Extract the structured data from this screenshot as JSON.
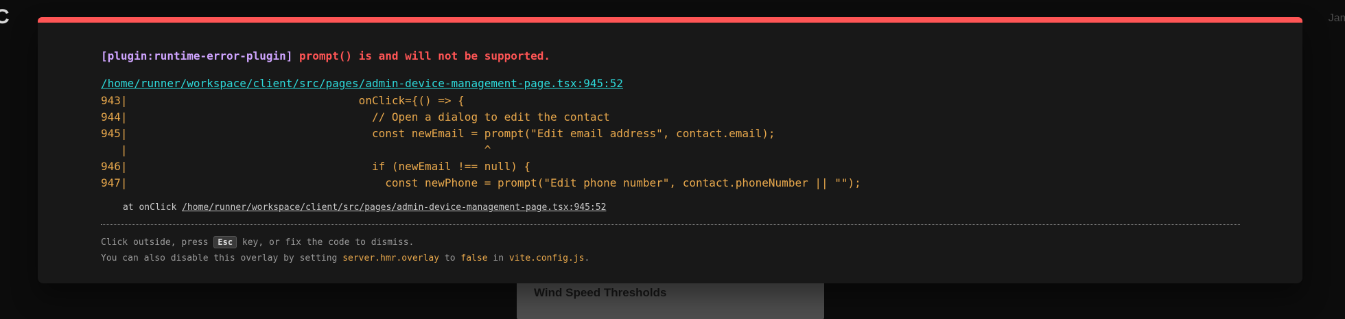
{
  "background": {
    "logo_text": "C",
    "user_text": "Jam",
    "card_title": "Wind Speed Thresholds"
  },
  "overlay": {
    "plugin": "[plugin:runtime-error-plugin]",
    "message": " prompt() is and will not be supported.",
    "file": "/home/runner/workspace/client/src/pages/admin-device-management-page.tsx:945:52",
    "code_lines": [
      "943|                                   onClick={() => {",
      "944|                                     // Open a dialog to edit the contact",
      "945|                                     const newEmail = prompt(\"Edit email address\", contact.email);",
      "   |                                                      ^",
      "946|                                     if (newEmail !== null) {",
      "947|                                       const newPhone = prompt(\"Edit phone number\", contact.phoneNumber || \"\");"
    ],
    "stack_prefix": "at onClick ",
    "stack_link": "/home/runner/workspace/client/src/pages/admin-device-management-page.tsx:945:52",
    "tip1_before": "Click outside, press ",
    "tip1_key": "Esc",
    "tip1_after": " key, or fix the code to dismiss.",
    "tip2_before": "You can also disable this overlay by setting ",
    "tip2_code1": "server.hmr.overlay",
    "tip2_mid": " to ",
    "tip2_code2": "false",
    "tip2_mid2": " in ",
    "tip2_code3": "vite.config.js",
    "tip2_end": "."
  },
  "colors": {
    "accent_red": "#ff5555",
    "plugin_purple": "#cfa4ff",
    "link_cyan": "#2dd9da",
    "code_orange": "#e8a84c"
  }
}
